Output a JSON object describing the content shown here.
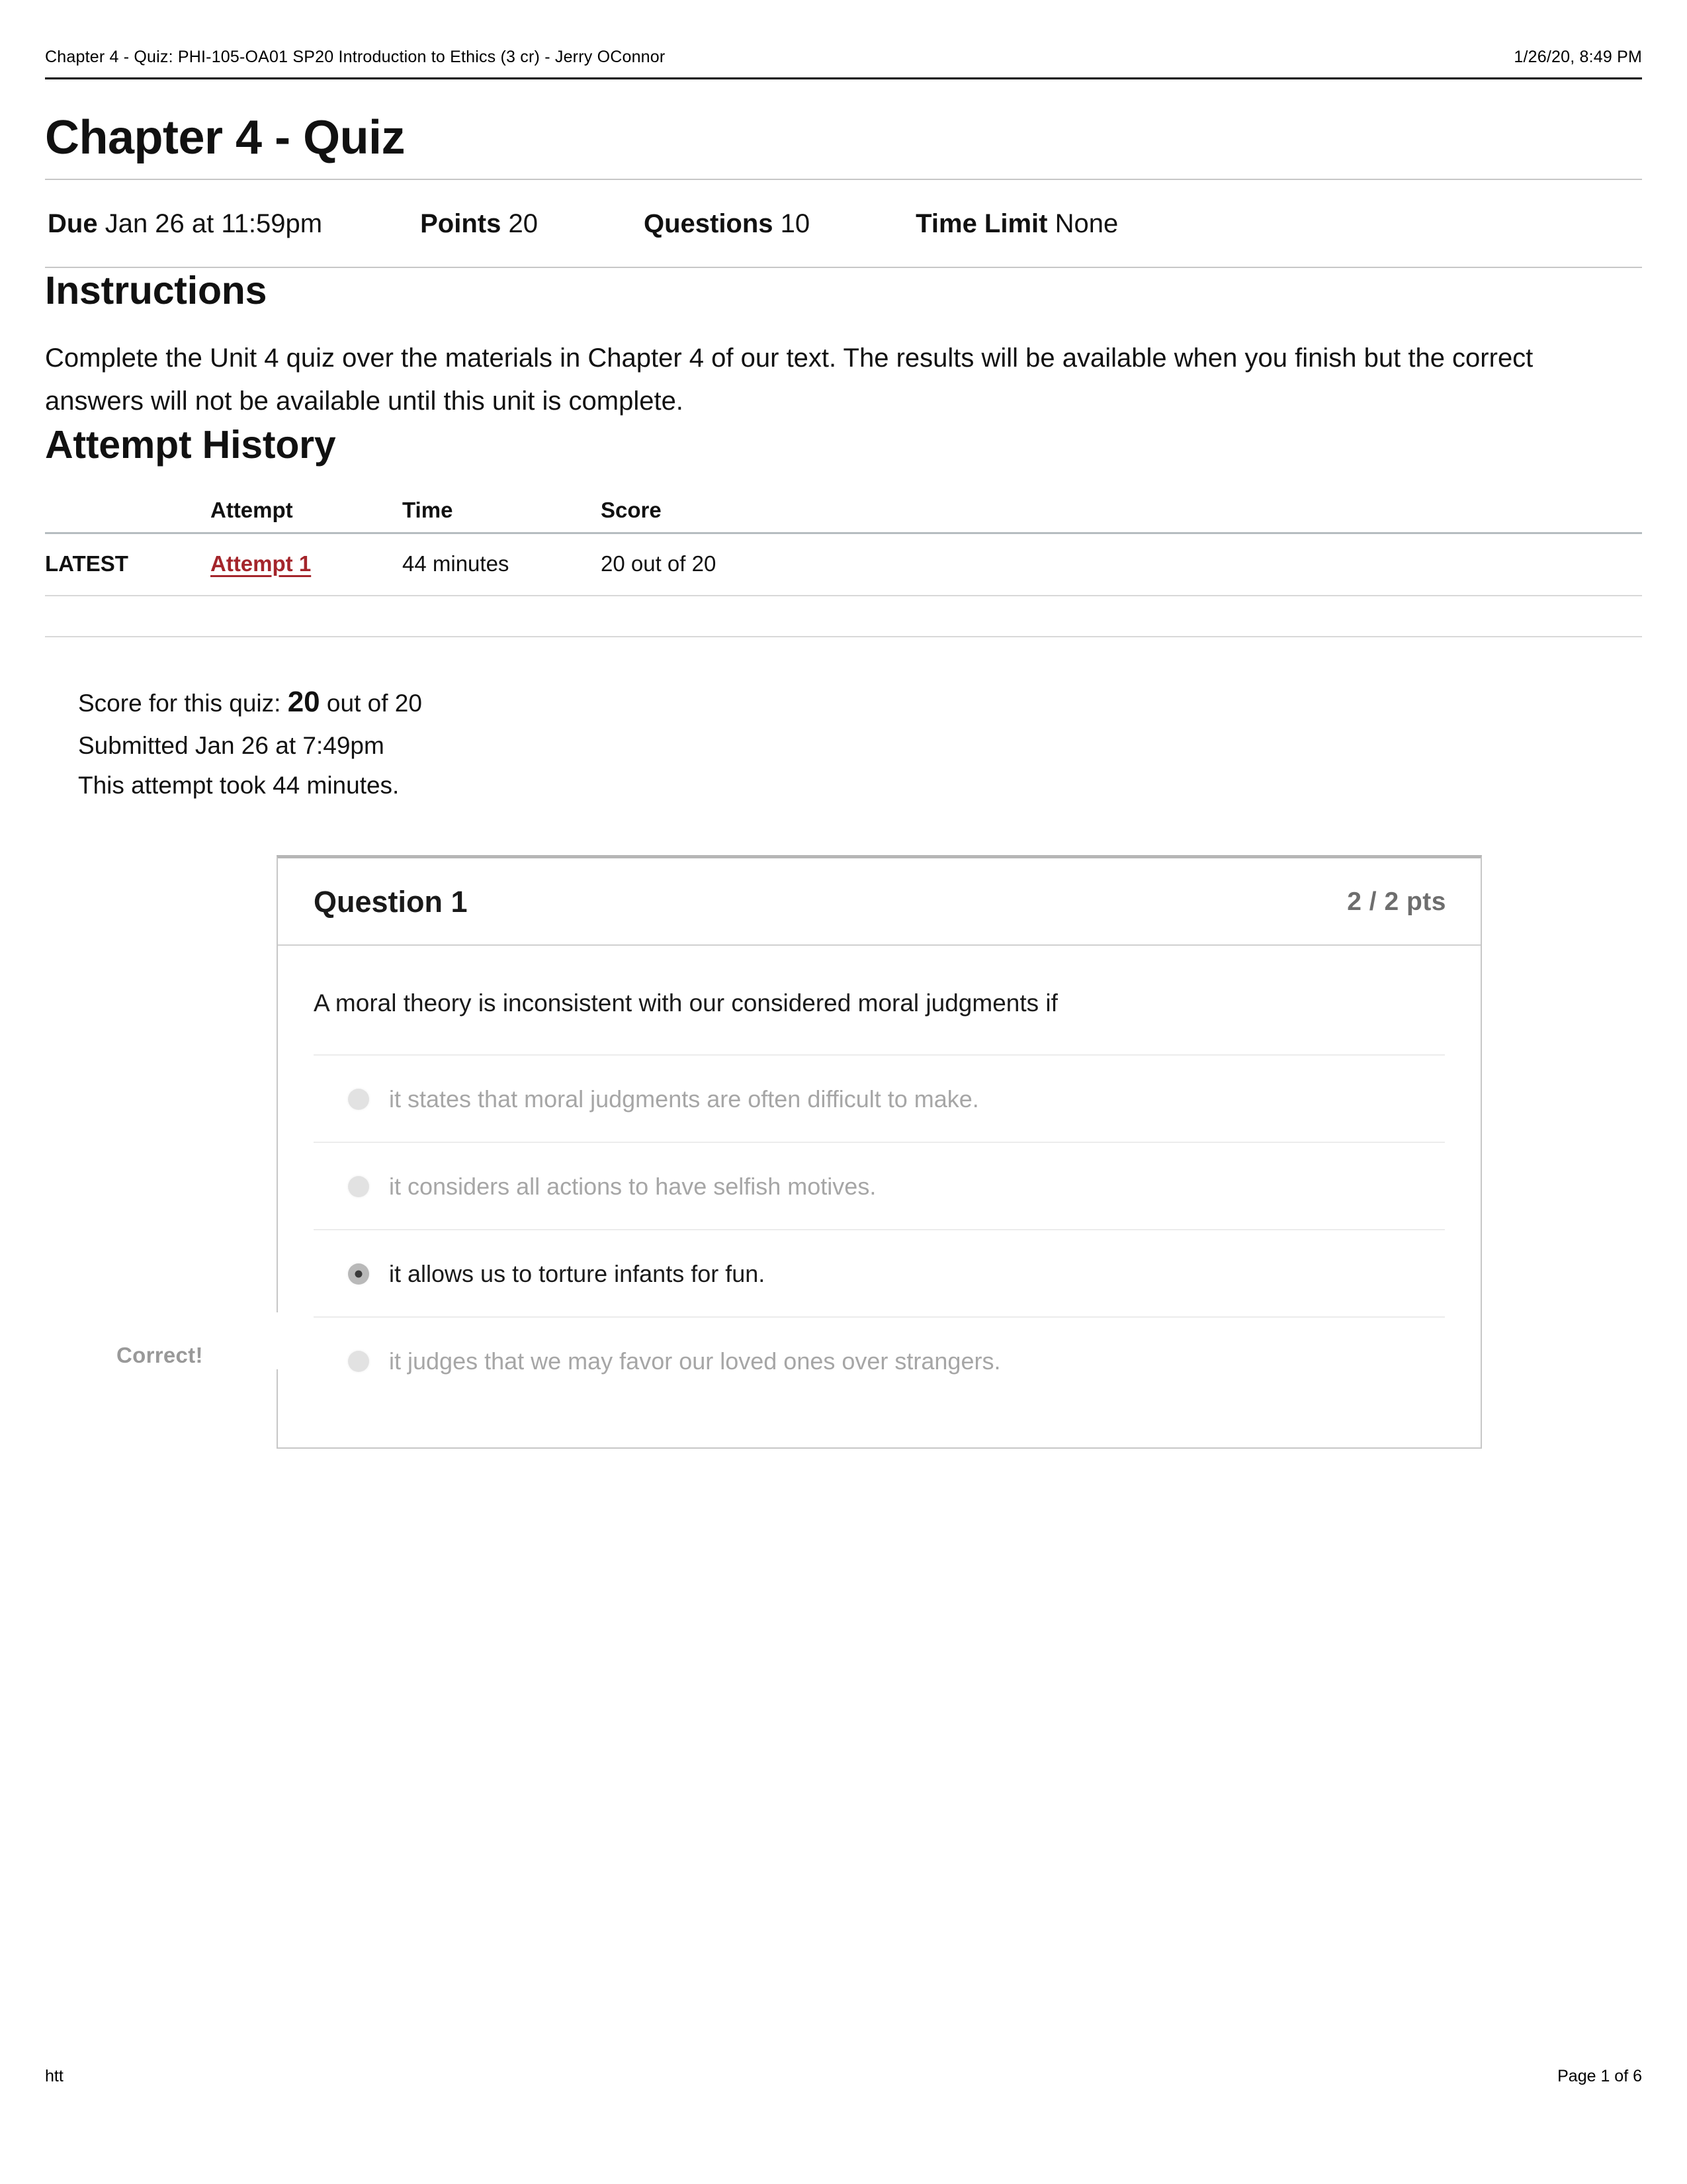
{
  "print_header": {
    "left": "Chapter 4 - Quiz: PHI-105-OA01 SP20 Introduction to Ethics (3 cr) - Jerry OConnor",
    "right": "1/26/20, 8:49 PM"
  },
  "quiz": {
    "title": "Chapter 4 - Quiz",
    "meta": {
      "due_label": "Due",
      "due_value": "Jan 26 at 11:59pm",
      "points_label": "Points",
      "points_value": "20",
      "questions_label": "Questions",
      "questions_value": "10",
      "time_limit_label": "Time Limit",
      "time_limit_value": "None"
    }
  },
  "instructions": {
    "heading": "Instructions",
    "body": "Complete the Unit 4 quiz over the materials in Chapter 4 of our text. The results will be available when you finish but the correct answers will not be available until this unit is complete."
  },
  "attempt_history": {
    "heading": "Attempt History",
    "columns": [
      "",
      "Attempt",
      "Time",
      "Score"
    ],
    "rows": [
      {
        "kept": "LATEST",
        "attempt": "Attempt 1",
        "time": "44 minutes",
        "score": "20 out of 20"
      }
    ]
  },
  "score_summary": {
    "score_prefix": "Score for this quiz:",
    "score_value": "20",
    "score_suffix": "out of 20",
    "submitted": "Submitted Jan 26 at 7:49pm",
    "duration": "This attempt took 44 minutes."
  },
  "question": {
    "title": "Question 1",
    "points": "2 / 2 pts",
    "correct_flag": "Correct!",
    "text": "A moral theory is inconsistent with our considered moral judgments if",
    "answers": [
      {
        "label": "it states that moral judgments are often difficult to make.",
        "selected": false
      },
      {
        "label": "it considers all actions to have selfish motives.",
        "selected": false
      },
      {
        "label": "it allows us to torture infants for fun.",
        "selected": true
      },
      {
        "label": "it judges that we may favor our loved ones over strangers.",
        "selected": false
      }
    ]
  },
  "print_footer": {
    "left": "htt",
    "right": "Page 1 of 6"
  },
  "colors": {
    "link_red": "#a4252b",
    "rule_gray": "#c7c7c7",
    "muted_text": "#a6a6a6"
  }
}
